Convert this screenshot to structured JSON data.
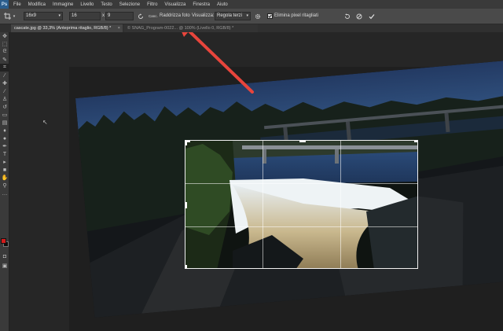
{
  "app": {
    "logo": "Ps"
  },
  "menu": [
    "File",
    "Modifica",
    "Immagine",
    "Livello",
    "Testo",
    "Selezione",
    "Filtro",
    "Visualizza",
    "Finestra",
    "Aiuto"
  ],
  "options": {
    "ratio_preset": "16x9",
    "width_value": "16",
    "times_symbol": "x",
    "height_value": "9",
    "clear_label": "Canc.",
    "straighten_label": "Raddrizza foto",
    "view_label": "Visualizza:",
    "view_value": "Regola terzi",
    "delete_pixels_label": "Elimina pixel ritagliati",
    "delete_pixels_checked": true
  },
  "tabs": {
    "active": "cascate.jpg @ 33,3% (Anteprima ritaglio, RGB/8) *",
    "inactive": "© SNAG_Program-0022... @ 100% (Livello 0, RGB/8) *"
  },
  "colors": {
    "foreground": "#d21b1b",
    "background": "#0e0e0e",
    "arrow": "#e8453c"
  },
  "icons": {
    "rotate": "rotate-icon",
    "gear": "gear-icon",
    "reset": "reset-icon",
    "cancel": "cancel-icon",
    "commit": "checkmark-icon"
  }
}
